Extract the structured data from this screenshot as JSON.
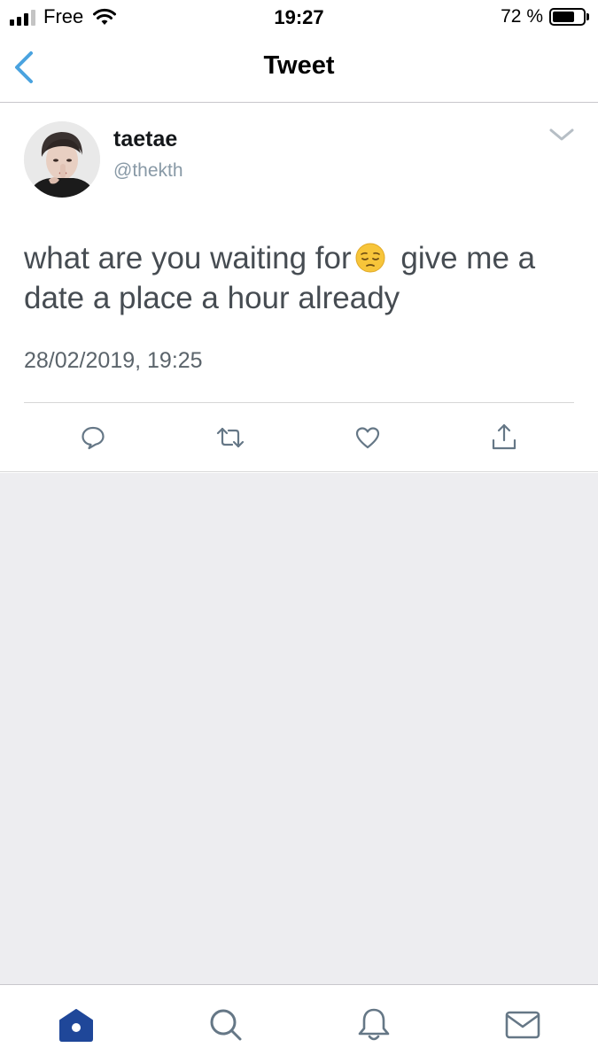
{
  "status_bar": {
    "carrier": "Free",
    "time": "19:27",
    "battery_percent": "72 %",
    "battery_level": 0.72,
    "signal_bars": 3
  },
  "nav": {
    "title": "Tweet",
    "back_icon": "chevron-left-icon"
  },
  "tweet": {
    "display_name": "taetae",
    "handle": "@thekth",
    "text_part1": "what are you waiting for",
    "emoji": "pensive-face",
    "text_part2": "give me a date a place a hour already",
    "timestamp": "28/02/2019, 19:25",
    "actions": [
      "reply-icon",
      "retweet-icon",
      "like-icon",
      "share-icon"
    ]
  },
  "tab_bar": {
    "tabs": [
      "home-icon",
      "search-icon",
      "notifications-icon",
      "messages-icon"
    ],
    "active": "home-icon"
  },
  "colors": {
    "accent": "#1da1f2",
    "tab_active": "#1f4799",
    "tab_inactive": "#657786",
    "text_secondary": "#8899a6",
    "background_empty": "#ededf0"
  }
}
